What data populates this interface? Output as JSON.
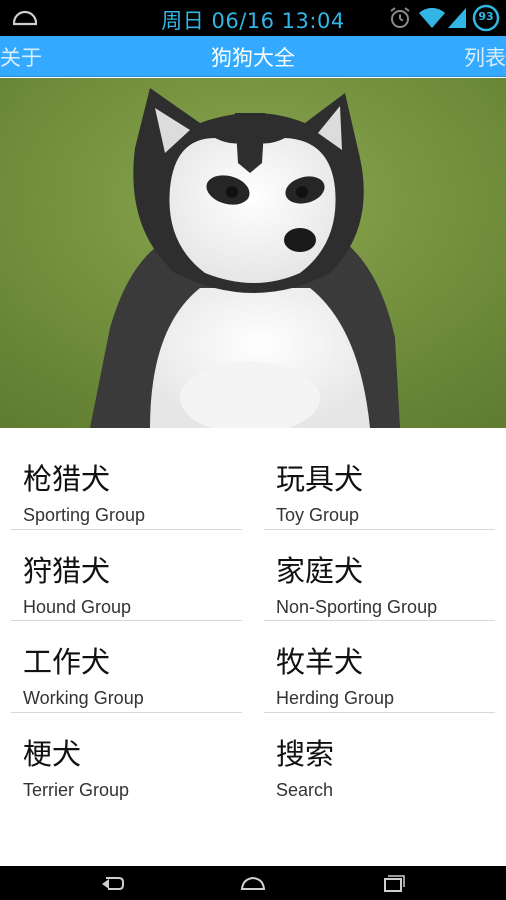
{
  "status_bar": {
    "clock": "周日 06/16 13:04",
    "battery_level": "93",
    "accent_color": "#33b5e5",
    "icons": [
      "notification-icon",
      "alarm-icon",
      "wifi-icon",
      "signal-icon",
      "battery-icon"
    ]
  },
  "action_bar": {
    "left_label": "关于",
    "title": "狗狗大全",
    "right_label": "列表",
    "background_color": "#33aaff"
  },
  "hero": {
    "image": "husky-puppy-photo"
  },
  "categories": [
    {
      "name_cn": "枪猎犬",
      "name_en": "Sporting Group"
    },
    {
      "name_cn": "玩具犬",
      "name_en": "Toy Group"
    },
    {
      "name_cn": "狩猎犬",
      "name_en": "Hound Group"
    },
    {
      "name_cn": "家庭犬",
      "name_en": "Non-Sporting Group"
    },
    {
      "name_cn": "工作犬",
      "name_en": "Working Group"
    },
    {
      "name_cn": "牧羊犬",
      "name_en": "Herding Group"
    },
    {
      "name_cn": "梗犬",
      "name_en": "Terrier Group"
    },
    {
      "name_cn": "搜索",
      "name_en": "Search"
    }
  ],
  "nav_bar": {
    "icons": [
      "back-icon",
      "home-icon",
      "recent-apps-icon"
    ]
  }
}
